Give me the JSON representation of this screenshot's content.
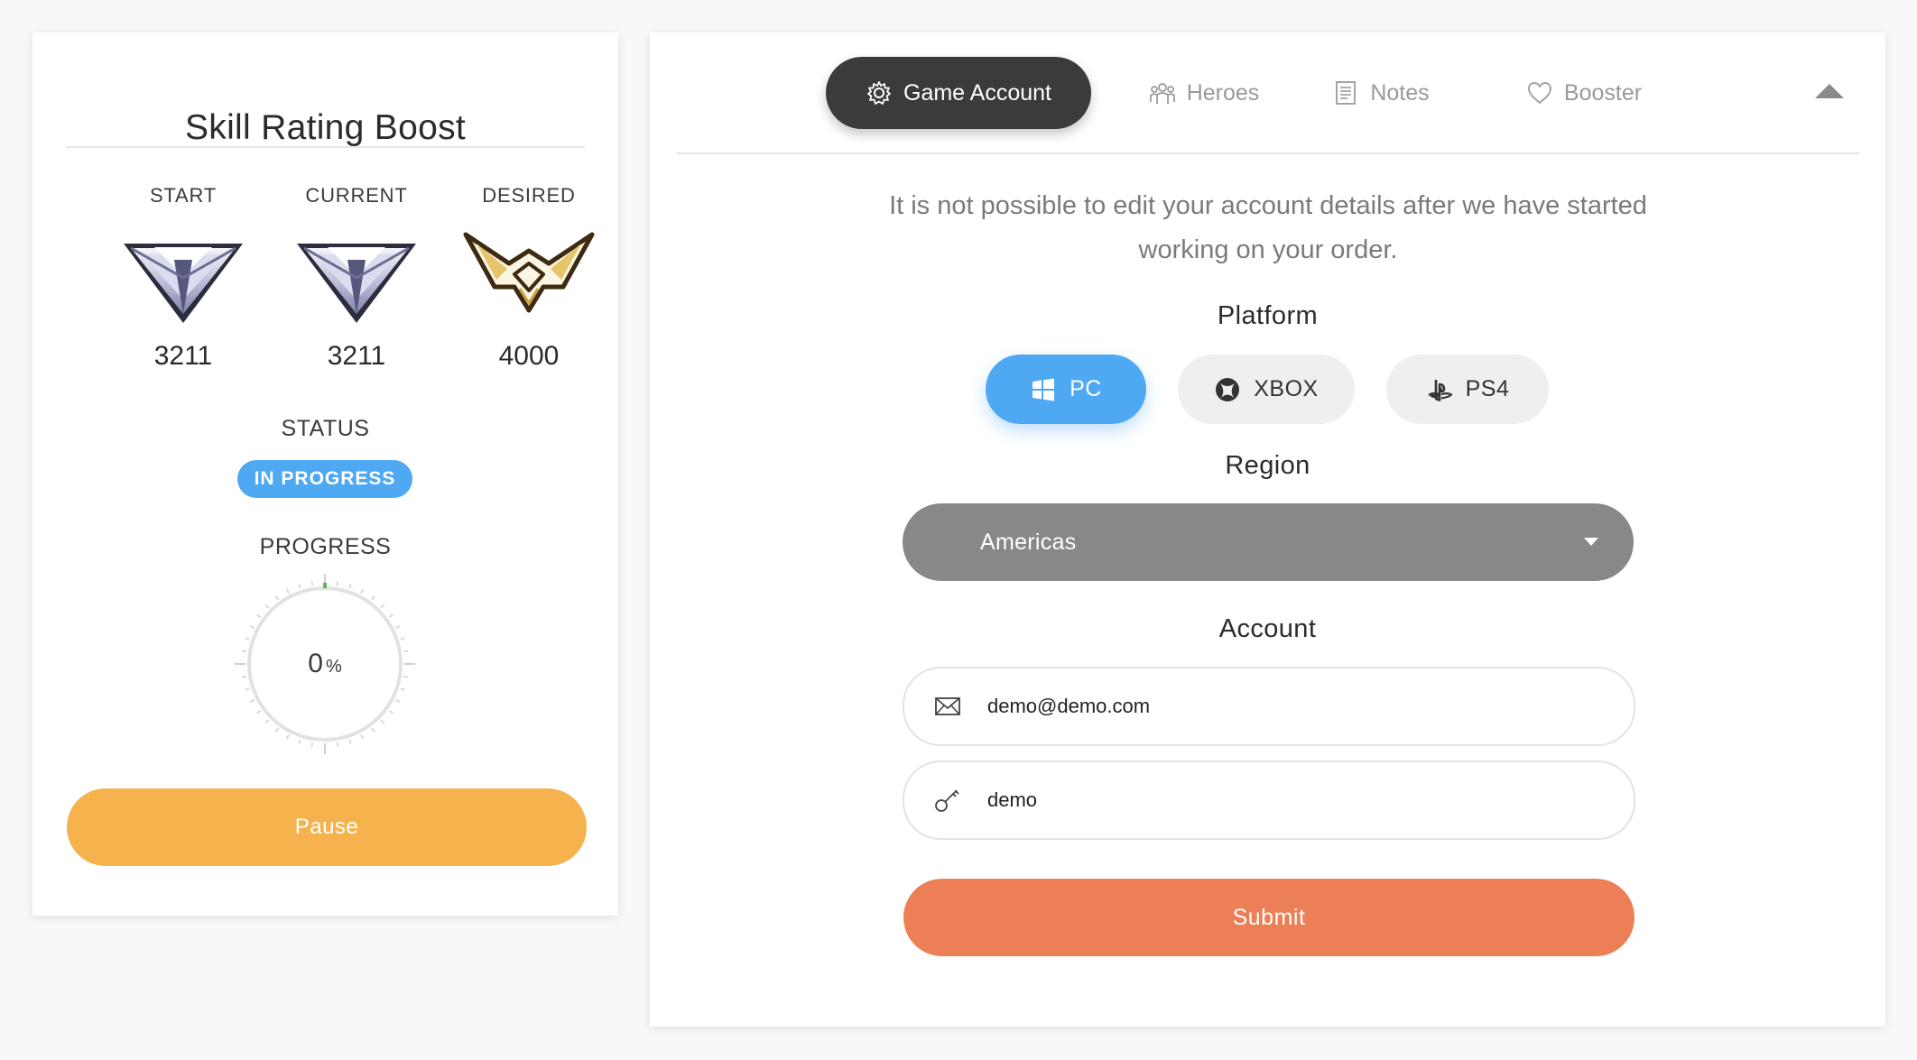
{
  "colors": {
    "accent_blue": "#4ea8f2",
    "pause_orange": "#f5b24d",
    "submit_orange": "#ec7f56",
    "tab_active_bg": "#3b3b3b",
    "select_gray": "#888888",
    "progress_tick_green": "#5cb85c"
  },
  "boost_panel": {
    "title": "Skill Rating Boost",
    "ranks": [
      {
        "label": "START",
        "value": "3211",
        "badge_icon": "master-rank-badge-icon"
      },
      {
        "label": "CURRENT",
        "value": "3211",
        "badge_icon": "master-rank-badge-icon"
      },
      {
        "label": "DESIRED",
        "value": "4000",
        "badge_icon": "grandmaster-rank-badge-icon"
      }
    ],
    "status_label": "STATUS",
    "status_value": "IN PROGRESS",
    "progress_label": "PROGRESS",
    "progress_value": "0",
    "progress_unit": "%",
    "progress_fraction": 0,
    "pause_label": "Pause"
  },
  "tabs": [
    {
      "label": "Game Account",
      "icon": "gear-icon",
      "active": true
    },
    {
      "label": "Heroes",
      "icon": "group-icon",
      "active": false
    },
    {
      "label": "Notes",
      "icon": "notes-icon",
      "active": false
    },
    {
      "label": "Booster",
      "icon": "heart-icon",
      "active": false
    }
  ],
  "collapse_icon": "caret-up-icon",
  "account_form": {
    "notice": "It is not possible to edit your account details after we have started working on your order.",
    "platform_label": "Platform",
    "platforms": [
      {
        "label": "PC",
        "icon": "windows-icon",
        "selected": true
      },
      {
        "label": "XBOX",
        "icon": "xbox-icon",
        "selected": false
      },
      {
        "label": "PS4",
        "icon": "playstation-icon",
        "selected": false
      }
    ],
    "region_label": "Region",
    "region_value": "Americas",
    "account_label": "Account",
    "email_value": "demo@demo.com",
    "email_icon": "envelope-icon",
    "password_value": "demo",
    "password_icon": "key-icon",
    "submit_label": "Submit"
  }
}
